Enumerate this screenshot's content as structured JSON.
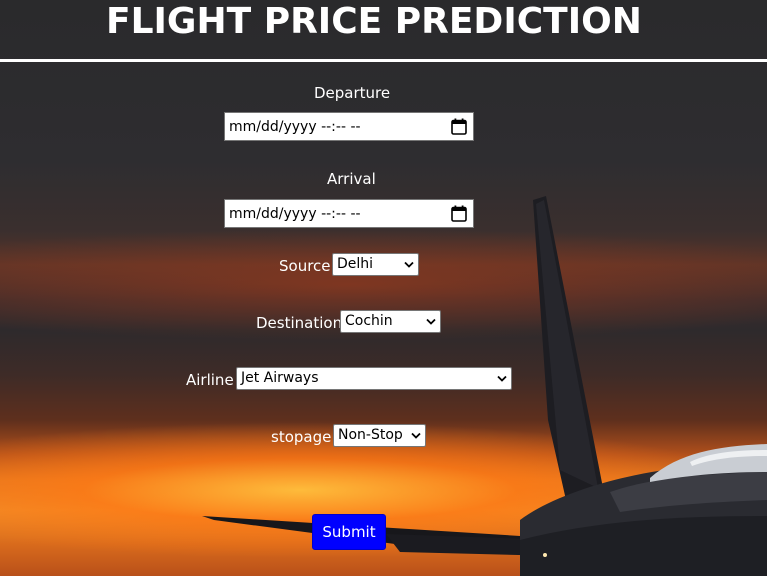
{
  "header": {
    "title": "FLIGHT PRICE PREDICTION"
  },
  "form": {
    "departure": {
      "label": "Departure",
      "placeholder": "mm/dd/yyyy --:-- --"
    },
    "arrival": {
      "label": "Arrival",
      "placeholder": "mm/dd/yyyy --:-- --"
    },
    "source": {
      "label": "Source",
      "selected": "Delhi"
    },
    "destination": {
      "label": "Destination",
      "selected": "Cochin"
    },
    "airline": {
      "label": "Airline",
      "selected": "Jet Airways"
    },
    "stopage": {
      "label": "stopage",
      "selected": "Non-Stop"
    },
    "submit_label": "Submit"
  },
  "icons": {
    "calendar": "calendar-icon",
    "dropdown": "chevron-down-icon"
  },
  "colors": {
    "header_rule": "#ffffff",
    "submit_bg": "#0000ff",
    "text": "#ffffff"
  }
}
